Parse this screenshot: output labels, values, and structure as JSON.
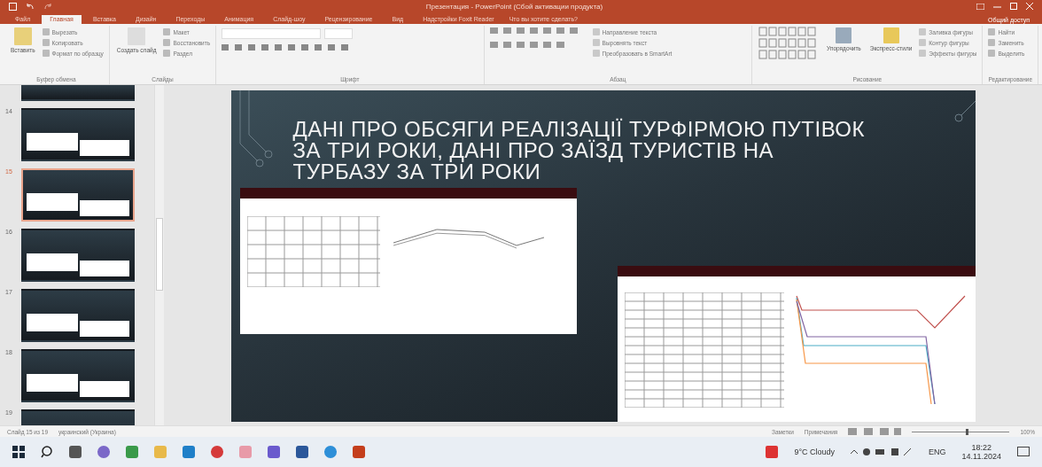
{
  "window": {
    "title": "Презентация - PowerPoint (Сбой активации продукта)"
  },
  "ribbon_tabs": [
    {
      "label": "Файл",
      "selected": false
    },
    {
      "label": "Главная",
      "selected": true
    },
    {
      "label": "Вставка",
      "selected": false
    },
    {
      "label": "Дизайн",
      "selected": false
    },
    {
      "label": "Переходы",
      "selected": false
    },
    {
      "label": "Анимация",
      "selected": false
    },
    {
      "label": "Слайд-шоу",
      "selected": false
    },
    {
      "label": "Рецензирование",
      "selected": false
    },
    {
      "label": "Вид",
      "selected": false
    },
    {
      "label": "Надстройки Foxit Reader",
      "selected": false
    }
  ],
  "tell_me": {
    "placeholder": "Что вы хотите сделать?"
  },
  "share": "Общий доступ",
  "ribbon_groups": [
    {
      "kind": "standard",
      "label": "Буфер обмена",
      "big": [
        "Вставить"
      ],
      "items": [
        "Вырезать",
        "Копировать",
        "Формат по образцу"
      ]
    },
    {
      "kind": "standard",
      "label": "Слайды",
      "big": [
        "Создать слайд"
      ],
      "items": [
        "Макет",
        "Восстановить",
        "Раздел"
      ]
    },
    {
      "kind": "font",
      "label": "Шрифт"
    },
    {
      "kind": "paragraph",
      "label": "Абзац",
      "items": [
        "Направление текста",
        "Выровнять текст",
        "Преобразовать в SmartArt"
      ]
    },
    {
      "kind": "drawing",
      "label": "Рисование",
      "big": [
        "Упорядочить",
        "Экспресс-стили"
      ],
      "items": [
        "Заливка фигуры",
        "Контур фигуры",
        "Эффекты фигуры"
      ]
    },
    {
      "kind": "standard",
      "label": "Редактирование",
      "items": [
        "Найти",
        "Заменить",
        "Выделить"
      ]
    }
  ],
  "thumbnails": [
    {
      "number": "14",
      "selected": false
    },
    {
      "number": "15",
      "selected": true
    },
    {
      "number": "16",
      "selected": false
    },
    {
      "number": "17",
      "selected": false
    },
    {
      "number": "18",
      "selected": false
    },
    {
      "number": "19",
      "selected": false
    }
  ],
  "slide": {
    "title": "ДАНІ ПРО ОБСЯГИ РЕАЛІЗАЦІЇ ТУРФІРМОЮ ПУТІВОК ЗА ТРИ РОКИ, ДАНІ ПРО ЗАЇЗД ТУРИСТІВ НА ТУРБАЗУ ЗА ТРИ РОКИ"
  },
  "status_bar": {
    "slide_info": "Слайд 15 из 19",
    "language": "украинский (Украина)",
    "notes": "Заметки",
    "comments": "Примечания",
    "zoom": "100%",
    "zoom_slider": {
      "level": 0.55
    }
  },
  "taskbar": {
    "weather": "9°C Cloudy",
    "language": "ENG",
    "time": "18:22",
    "date": "14.11.2024"
  }
}
